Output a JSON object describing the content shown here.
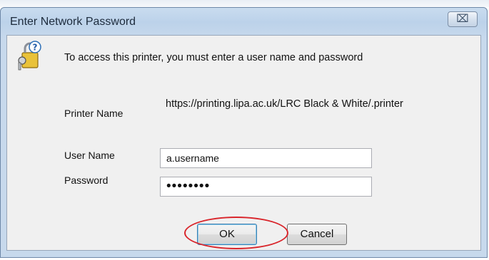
{
  "window": {
    "title": "Enter Network Password",
    "close_glyph": "⌧"
  },
  "dialog": {
    "icon": "key-lock-question-icon",
    "prompt": "To access this printer, you must enter a user name and password",
    "printer_name_label": "Printer Name",
    "printer_name_value": "https://printing.lipa.ac.uk/LRC Black & White/.printer",
    "user_name_label": "User Name",
    "user_name_value": "a.username",
    "password_label": "Password",
    "password_value": "••••••••"
  },
  "buttons": {
    "ok_label": "OK",
    "cancel_label": "Cancel"
  },
  "colors": {
    "highlight": "#d9252b",
    "titlebar": "#bcd2ea",
    "client_bg": "#f0f0f0"
  }
}
